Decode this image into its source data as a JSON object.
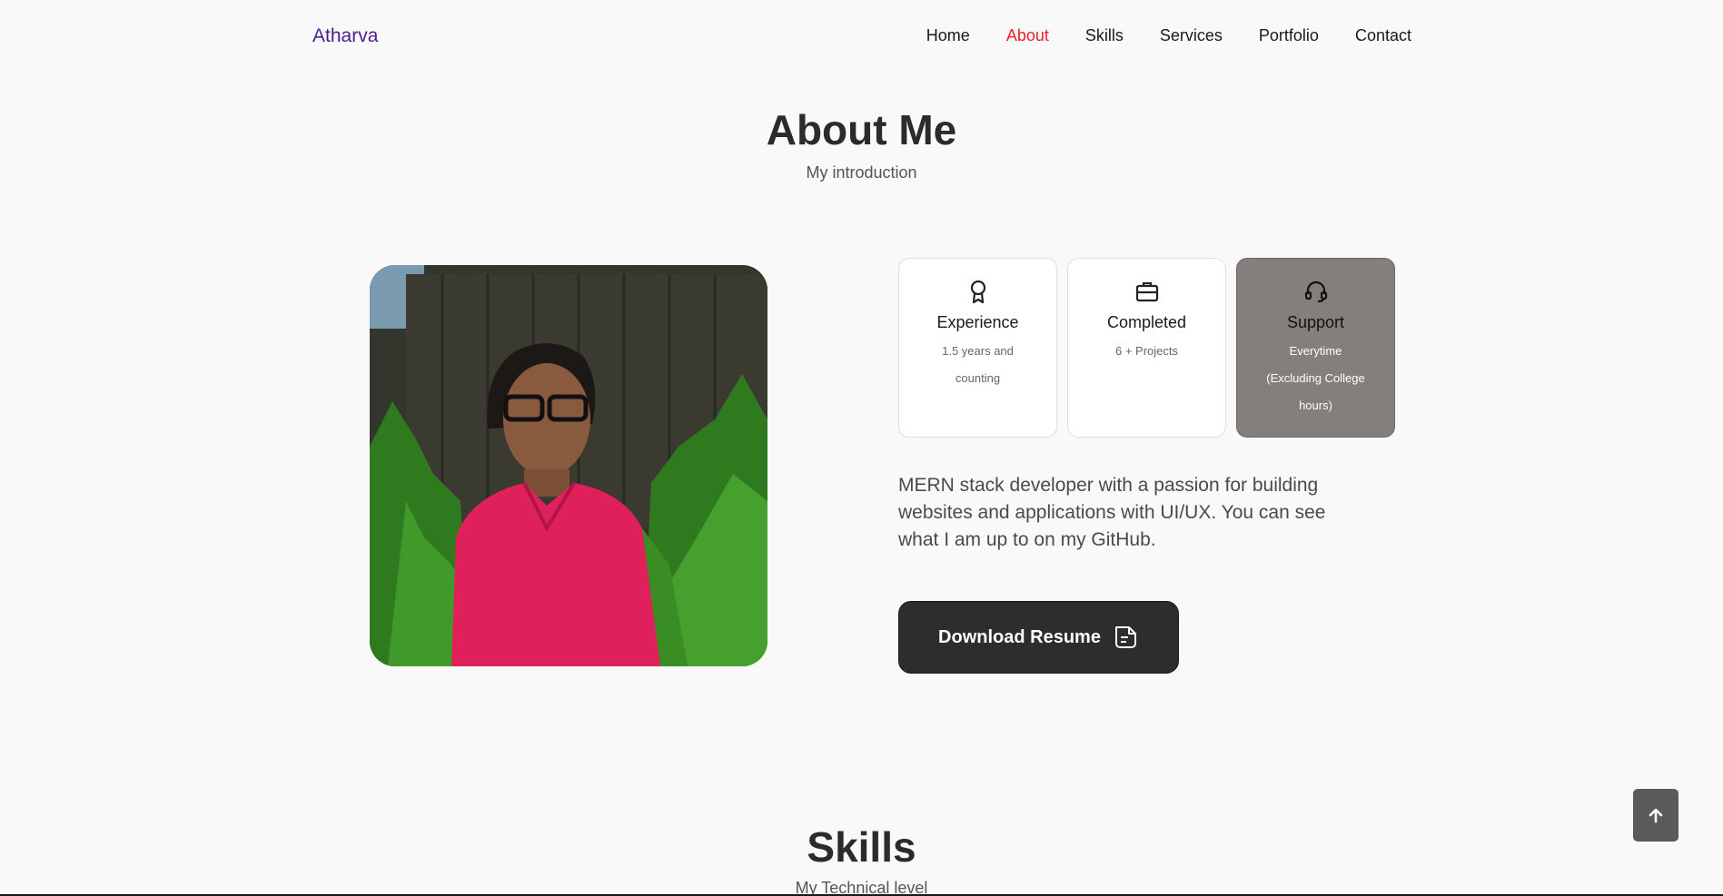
{
  "header": {
    "logo": "Atharva",
    "nav": [
      {
        "label": "Home",
        "active": false
      },
      {
        "label": "About",
        "active": true
      },
      {
        "label": "Skills",
        "active": false
      },
      {
        "label": "Services",
        "active": false
      },
      {
        "label": "Portfolio",
        "active": false
      },
      {
        "label": "Contact",
        "active": false
      }
    ]
  },
  "about": {
    "title": "About Me",
    "subtitle": "My introduction",
    "cards": [
      {
        "icon": "award-icon",
        "title": "Experience",
        "lines": [
          "1.5 years and",
          "counting"
        ]
      },
      {
        "icon": "briefcase-icon",
        "title": "Completed",
        "lines": [
          "6 + Projects"
        ]
      },
      {
        "icon": "headset-icon",
        "title": "Support",
        "lines": [
          "Everytime",
          "(Excluding College",
          "hours)"
        ]
      }
    ],
    "description": "MERN stack developer with a passion for building websites and applications with UI/UX. You can see what I am up to on my GitHub.",
    "resume_label": "Download Resume"
  },
  "skills": {
    "title": "Skills",
    "subtitle": "My Technical level"
  },
  "colors": {
    "accent": "#e8202a",
    "logo": "#4b1d8f",
    "button": "#2d2d2d",
    "card_highlight": "#847f7c"
  }
}
